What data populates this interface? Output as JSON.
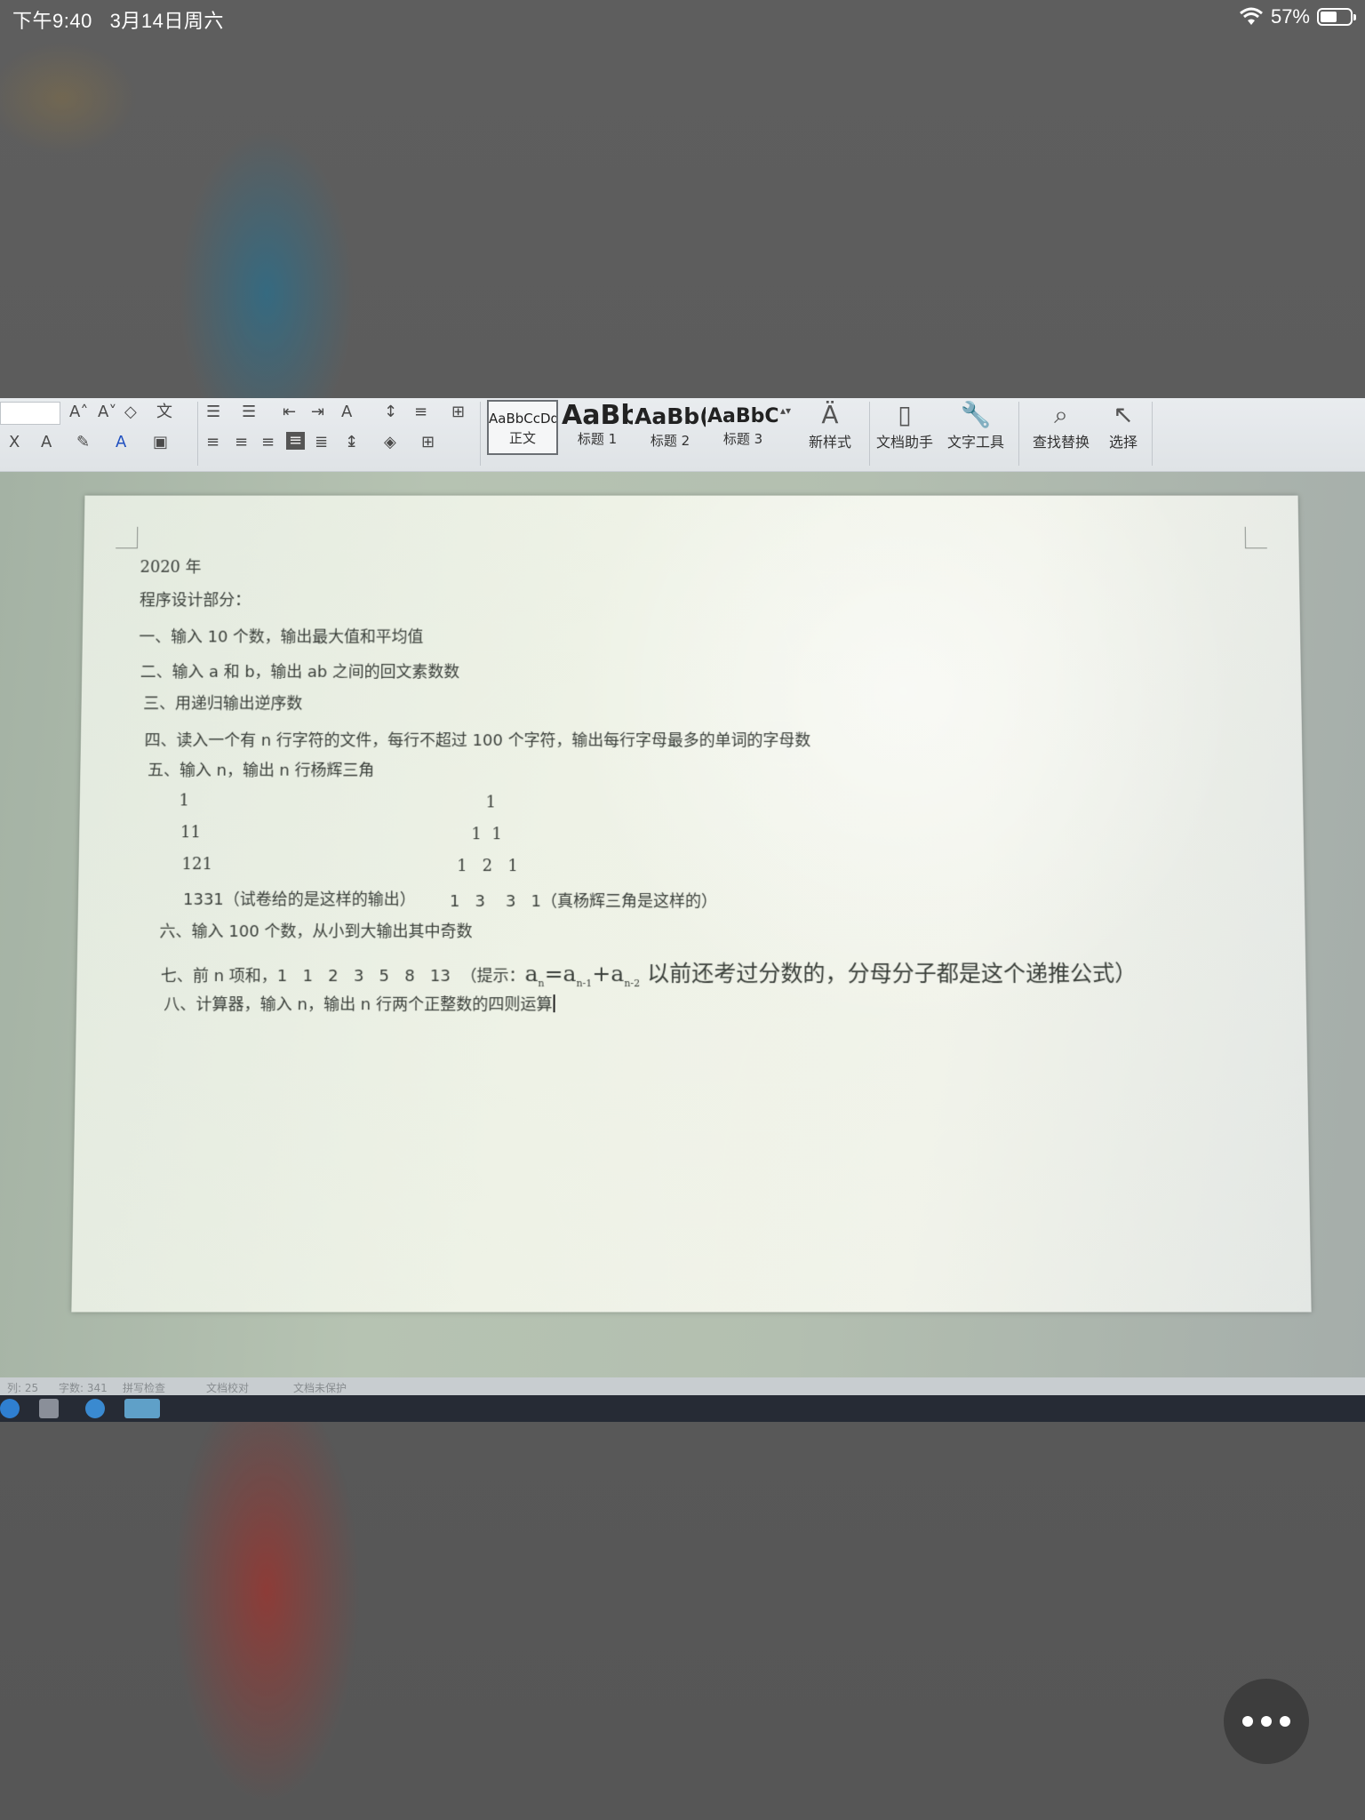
{
  "status_bar": {
    "time": "下午9:40",
    "date": "3月14日周六",
    "battery_percent": "57%",
    "battery_level": 0.57
  },
  "ribbon": {
    "styles": [
      {
        "sample": "AaBbCcDd",
        "label": "正文"
      },
      {
        "sample": "AaBb",
        "label": "标题 1"
      },
      {
        "sample": "AaBb(",
        "label": "标题 2"
      },
      {
        "sample": "AaBbC(",
        "label": "标题 3"
      }
    ],
    "new_style": "新样式",
    "doc_assistant": "文档助手",
    "text_tools": "文字工具",
    "find_replace": "查找替换",
    "select": "选择"
  },
  "document": {
    "year": "2020 年",
    "section_title": "程序设计部分：",
    "q1": "一、输入 10 个数，输出最大值和平均值",
    "q2": "二、输入 a 和 b，输出 ab 之间的回文素数数",
    "q3": "三、用递归输出逆序数",
    "q4": "四、读入一个有 n 行字符的文件，每行不超过 100 个字符，输出每行字母最多的单词的字母数",
    "q5": "五、输入 n，输出 n 行杨辉三角",
    "tri_left_1": "1",
    "tri_left_2": "11",
    "tri_left_3": "121",
    "tri_left_4": "1331（试卷给的是这样的输出）",
    "tri_right_1": "1",
    "tri_right_2": "1  1",
    "tri_right_3": "1   2   1",
    "tri_right_4": "1   3    3   1（真杨辉三角是这样的）",
    "q6": "六、输入 100 个数，从小到大输出其中奇数",
    "q7_prefix": "七、前 n 项和，1   1   2   3   5   8   13  （提示：",
    "q7_formula_a": "a",
    "q7_formula_n": "n",
    "q7_formula_eq": "=a",
    "q7_formula_n1": "n-1",
    "q7_formula_plus": "+a",
    "q7_formula_n2": "n-2",
    "q7_suffix": " 以前还考过分数的，分母分子都是这个递推公式）",
    "q8": "八、计算器，输入 n，输出 n 行两个正整数的四则运算"
  },
  "status_strip": {
    "page": "列: 25",
    "words": "字数: 341",
    "spell": "拼写检查",
    "proof": "文档校对",
    "protect": "文档未保护"
  }
}
